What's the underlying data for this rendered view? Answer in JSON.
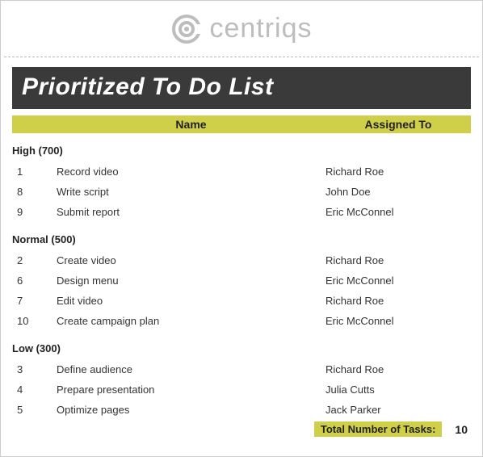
{
  "brand": {
    "name": "centriqs"
  },
  "title": "Prioritized To Do List",
  "columns": {
    "name": "Name",
    "assigned": "Assigned To"
  },
  "groups": [
    {
      "label": "High (700)",
      "tasks": [
        {
          "id": "1",
          "name": "Record video",
          "assigned": "Richard Roe"
        },
        {
          "id": "8",
          "name": "Write script",
          "assigned": "John Doe"
        },
        {
          "id": "9",
          "name": "Submit report",
          "assigned": "Eric McConnel"
        }
      ]
    },
    {
      "label": "Normal (500)",
      "tasks": [
        {
          "id": "2",
          "name": "Create video",
          "assigned": "Richard Roe"
        },
        {
          "id": "6",
          "name": "Design menu",
          "assigned": "Eric McConnel"
        },
        {
          "id": "7",
          "name": "Edit video",
          "assigned": "Richard Roe"
        },
        {
          "id": "10",
          "name": "Create campaign plan",
          "assigned": "Eric McConnel"
        }
      ]
    },
    {
      "label": "Low (300)",
      "tasks": [
        {
          "id": "3",
          "name": "Define audience",
          "assigned": "Richard Roe"
        },
        {
          "id": "4",
          "name": "Prepare presentation",
          "assigned": "Julia Cutts"
        },
        {
          "id": "5",
          "name": "Optimize pages",
          "assigned": "Jack Parker"
        }
      ]
    }
  ],
  "footer": {
    "label": "Total Number of Tasks:",
    "count": "10"
  }
}
